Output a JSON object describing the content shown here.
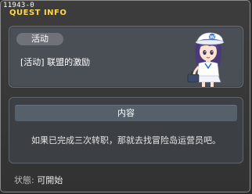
{
  "window": {
    "id_text": "11943-0",
    "title": "QUEST INFO"
  },
  "quest": {
    "category": "活动",
    "name": "[活动] 联盟的激励"
  },
  "content": {
    "header": "内容",
    "description": "如果已完成三次转职，那就去找冒险岛运营员吧。"
  },
  "status": {
    "label": "状態:",
    "value": "可開始"
  },
  "colors": {
    "title": "#ffd84a",
    "panel": "#4a4e55",
    "header_bar": "#55606b"
  },
  "icons": {
    "npc": "operator-npc-portrait"
  }
}
